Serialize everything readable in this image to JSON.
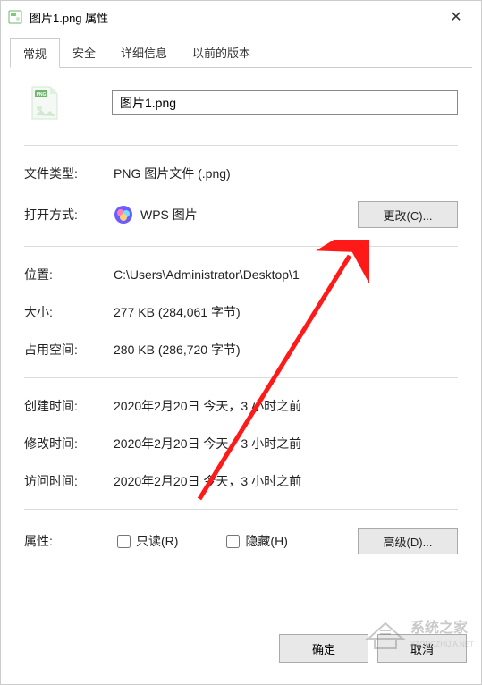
{
  "titlebar": {
    "title": "图片1.png 属性"
  },
  "tabs": [
    {
      "label": "常规",
      "active": true
    },
    {
      "label": "安全",
      "active": false
    },
    {
      "label": "详细信息",
      "active": false
    },
    {
      "label": "以前的版本",
      "active": false
    }
  ],
  "file": {
    "name": "图片1.png",
    "labels": {
      "type": "文件类型:",
      "openwith": "打开方式:",
      "location": "位置:",
      "size": "大小:",
      "sizedisk": "占用空间:",
      "created": "创建时间:",
      "modified": "修改时间:",
      "accessed": "访问时间:",
      "attributes": "属性:"
    },
    "values": {
      "type": "PNG 图片文件 (.png)",
      "openwith_app": "WPS 图片",
      "location": "C:\\Users\\Administrator\\Desktop\\1",
      "size": "277 KB (284,061 字节)",
      "sizedisk": "280 KB (286,720 字节)",
      "created": "2020年2月20日 今天，3 小时之前",
      "modified": "2020年2月20日 今天，3 小时之前",
      "accessed": "2020年2月20日 今天，3 小时之前"
    },
    "buttons": {
      "change": "更改(C)...",
      "advanced": "高级(D)..."
    },
    "checkboxes": {
      "readonly": "只读(R)",
      "hidden": "隐藏(H)"
    }
  },
  "footer": {
    "ok": "确定",
    "cancel": "取消"
  },
  "watermark": {
    "line1": "系统之家",
    "line2": "XTONGZHIJIA.NET"
  }
}
